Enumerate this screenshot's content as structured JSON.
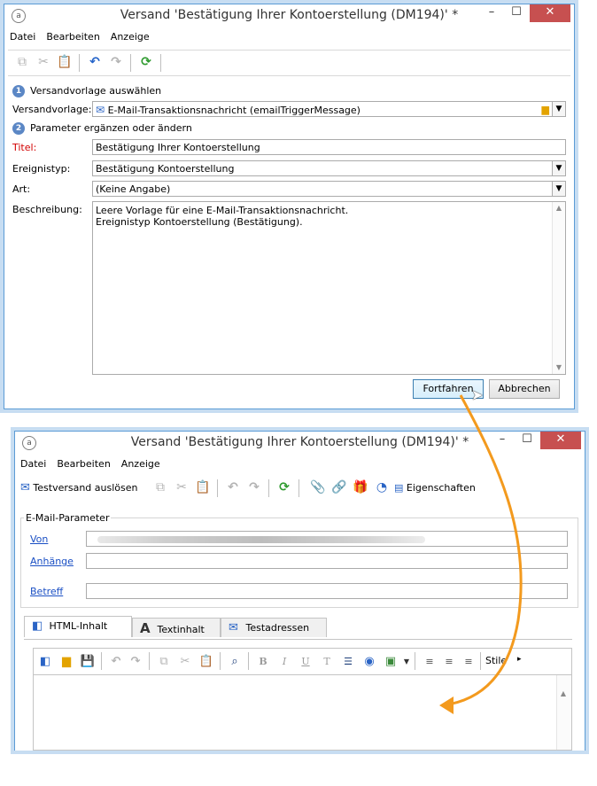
{
  "window1": {
    "title": "Versand 'Bestätigung Ihrer Kontoerstellung (DM194)' *",
    "menu": [
      "Datei",
      "Bearbeiten",
      "Anzeige"
    ],
    "step1_label": "Versandvorlage auswählen",
    "step1_num": "1",
    "template_label": "Versandvorlage:",
    "template_value": "E-Mail-Transaktionsnachricht (emailTriggerMessage)",
    "step2_label": "Parameter ergänzen oder ändern",
    "step2_num": "2",
    "title_label": "Titel:",
    "title_value": "Bestätigung Ihrer Kontoerstellung",
    "event_label": "Ereignistyp:",
    "event_value": "Bestätigung Kontoerstellung",
    "kind_label": "Art:",
    "kind_value": "(Keine Angabe)",
    "desc_label": "Beschreibung:",
    "desc_line1": "Leere Vorlage für eine E-Mail-Transaktionsnachricht.",
    "desc_line2": "Ereignistyp Kontoerstellung (Bestätigung).",
    "continue_button": "Fortfahren",
    "cancel_button": "Abbrechen"
  },
  "window2": {
    "title": "Versand 'Bestätigung Ihrer Kontoerstellung (DM194)' *",
    "menu": [
      "Datei",
      "Bearbeiten",
      "Anzeige"
    ],
    "test_send": "Testversand auslösen",
    "properties": "Eigenschaften",
    "group_title": "E-Mail-Parameter",
    "from_link": "Von",
    "attachments_link": "Anhänge",
    "subject_link": "Betreff",
    "tabs": [
      "HTML-Inhalt",
      "Textinhalt",
      "Testadressen"
    ],
    "styles": "Stile"
  },
  "colors": {
    "window_border": "#5b9bd5",
    "close_button": "#c75050",
    "step_circle": "#5b87c5",
    "required_label": "#d20000",
    "link": "#1a4fc4",
    "arrow": "#f39a1e"
  }
}
